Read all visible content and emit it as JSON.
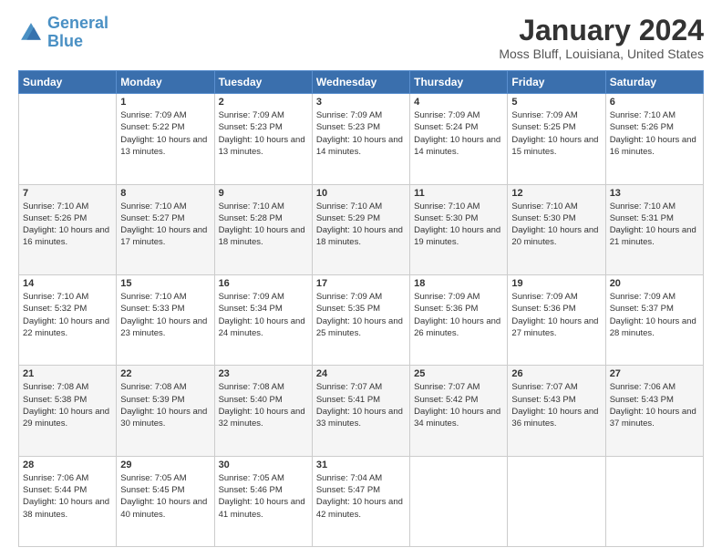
{
  "logo": {
    "line1": "General",
    "line2": "Blue"
  },
  "title": "January 2024",
  "subtitle": "Moss Bluff, Louisiana, United States",
  "weekdays": [
    "Sunday",
    "Monday",
    "Tuesday",
    "Wednesday",
    "Thursday",
    "Friday",
    "Saturday"
  ],
  "weeks": [
    [
      {
        "day": "",
        "sunrise": "",
        "sunset": "",
        "daylight": ""
      },
      {
        "day": "1",
        "sunrise": "Sunrise: 7:09 AM",
        "sunset": "Sunset: 5:22 PM",
        "daylight": "Daylight: 10 hours and 13 minutes."
      },
      {
        "day": "2",
        "sunrise": "Sunrise: 7:09 AM",
        "sunset": "Sunset: 5:23 PM",
        "daylight": "Daylight: 10 hours and 13 minutes."
      },
      {
        "day": "3",
        "sunrise": "Sunrise: 7:09 AM",
        "sunset": "Sunset: 5:23 PM",
        "daylight": "Daylight: 10 hours and 14 minutes."
      },
      {
        "day": "4",
        "sunrise": "Sunrise: 7:09 AM",
        "sunset": "Sunset: 5:24 PM",
        "daylight": "Daylight: 10 hours and 14 minutes."
      },
      {
        "day": "5",
        "sunrise": "Sunrise: 7:09 AM",
        "sunset": "Sunset: 5:25 PM",
        "daylight": "Daylight: 10 hours and 15 minutes."
      },
      {
        "day": "6",
        "sunrise": "Sunrise: 7:10 AM",
        "sunset": "Sunset: 5:26 PM",
        "daylight": "Daylight: 10 hours and 16 minutes."
      }
    ],
    [
      {
        "day": "7",
        "sunrise": "Sunrise: 7:10 AM",
        "sunset": "Sunset: 5:26 PM",
        "daylight": "Daylight: 10 hours and 16 minutes."
      },
      {
        "day": "8",
        "sunrise": "Sunrise: 7:10 AM",
        "sunset": "Sunset: 5:27 PM",
        "daylight": "Daylight: 10 hours and 17 minutes."
      },
      {
        "day": "9",
        "sunrise": "Sunrise: 7:10 AM",
        "sunset": "Sunset: 5:28 PM",
        "daylight": "Daylight: 10 hours and 18 minutes."
      },
      {
        "day": "10",
        "sunrise": "Sunrise: 7:10 AM",
        "sunset": "Sunset: 5:29 PM",
        "daylight": "Daylight: 10 hours and 18 minutes."
      },
      {
        "day": "11",
        "sunrise": "Sunrise: 7:10 AM",
        "sunset": "Sunset: 5:30 PM",
        "daylight": "Daylight: 10 hours and 19 minutes."
      },
      {
        "day": "12",
        "sunrise": "Sunrise: 7:10 AM",
        "sunset": "Sunset: 5:30 PM",
        "daylight": "Daylight: 10 hours and 20 minutes."
      },
      {
        "day": "13",
        "sunrise": "Sunrise: 7:10 AM",
        "sunset": "Sunset: 5:31 PM",
        "daylight": "Daylight: 10 hours and 21 minutes."
      }
    ],
    [
      {
        "day": "14",
        "sunrise": "Sunrise: 7:10 AM",
        "sunset": "Sunset: 5:32 PM",
        "daylight": "Daylight: 10 hours and 22 minutes."
      },
      {
        "day": "15",
        "sunrise": "Sunrise: 7:10 AM",
        "sunset": "Sunset: 5:33 PM",
        "daylight": "Daylight: 10 hours and 23 minutes."
      },
      {
        "day": "16",
        "sunrise": "Sunrise: 7:09 AM",
        "sunset": "Sunset: 5:34 PM",
        "daylight": "Daylight: 10 hours and 24 minutes."
      },
      {
        "day": "17",
        "sunrise": "Sunrise: 7:09 AM",
        "sunset": "Sunset: 5:35 PM",
        "daylight": "Daylight: 10 hours and 25 minutes."
      },
      {
        "day": "18",
        "sunrise": "Sunrise: 7:09 AM",
        "sunset": "Sunset: 5:36 PM",
        "daylight": "Daylight: 10 hours and 26 minutes."
      },
      {
        "day": "19",
        "sunrise": "Sunrise: 7:09 AM",
        "sunset": "Sunset: 5:36 PM",
        "daylight": "Daylight: 10 hours and 27 minutes."
      },
      {
        "day": "20",
        "sunrise": "Sunrise: 7:09 AM",
        "sunset": "Sunset: 5:37 PM",
        "daylight": "Daylight: 10 hours and 28 minutes."
      }
    ],
    [
      {
        "day": "21",
        "sunrise": "Sunrise: 7:08 AM",
        "sunset": "Sunset: 5:38 PM",
        "daylight": "Daylight: 10 hours and 29 minutes."
      },
      {
        "day": "22",
        "sunrise": "Sunrise: 7:08 AM",
        "sunset": "Sunset: 5:39 PM",
        "daylight": "Daylight: 10 hours and 30 minutes."
      },
      {
        "day": "23",
        "sunrise": "Sunrise: 7:08 AM",
        "sunset": "Sunset: 5:40 PM",
        "daylight": "Daylight: 10 hours and 32 minutes."
      },
      {
        "day": "24",
        "sunrise": "Sunrise: 7:07 AM",
        "sunset": "Sunset: 5:41 PM",
        "daylight": "Daylight: 10 hours and 33 minutes."
      },
      {
        "day": "25",
        "sunrise": "Sunrise: 7:07 AM",
        "sunset": "Sunset: 5:42 PM",
        "daylight": "Daylight: 10 hours and 34 minutes."
      },
      {
        "day": "26",
        "sunrise": "Sunrise: 7:07 AM",
        "sunset": "Sunset: 5:43 PM",
        "daylight": "Daylight: 10 hours and 36 minutes."
      },
      {
        "day": "27",
        "sunrise": "Sunrise: 7:06 AM",
        "sunset": "Sunset: 5:43 PM",
        "daylight": "Daylight: 10 hours and 37 minutes."
      }
    ],
    [
      {
        "day": "28",
        "sunrise": "Sunrise: 7:06 AM",
        "sunset": "Sunset: 5:44 PM",
        "daylight": "Daylight: 10 hours and 38 minutes."
      },
      {
        "day": "29",
        "sunrise": "Sunrise: 7:05 AM",
        "sunset": "Sunset: 5:45 PM",
        "daylight": "Daylight: 10 hours and 40 minutes."
      },
      {
        "day": "30",
        "sunrise": "Sunrise: 7:05 AM",
        "sunset": "Sunset: 5:46 PM",
        "daylight": "Daylight: 10 hours and 41 minutes."
      },
      {
        "day": "31",
        "sunrise": "Sunrise: 7:04 AM",
        "sunset": "Sunset: 5:47 PM",
        "daylight": "Daylight: 10 hours and 42 minutes."
      },
      {
        "day": "",
        "sunrise": "",
        "sunset": "",
        "daylight": ""
      },
      {
        "day": "",
        "sunrise": "",
        "sunset": "",
        "daylight": ""
      },
      {
        "day": "",
        "sunrise": "",
        "sunset": "",
        "daylight": ""
      }
    ]
  ]
}
